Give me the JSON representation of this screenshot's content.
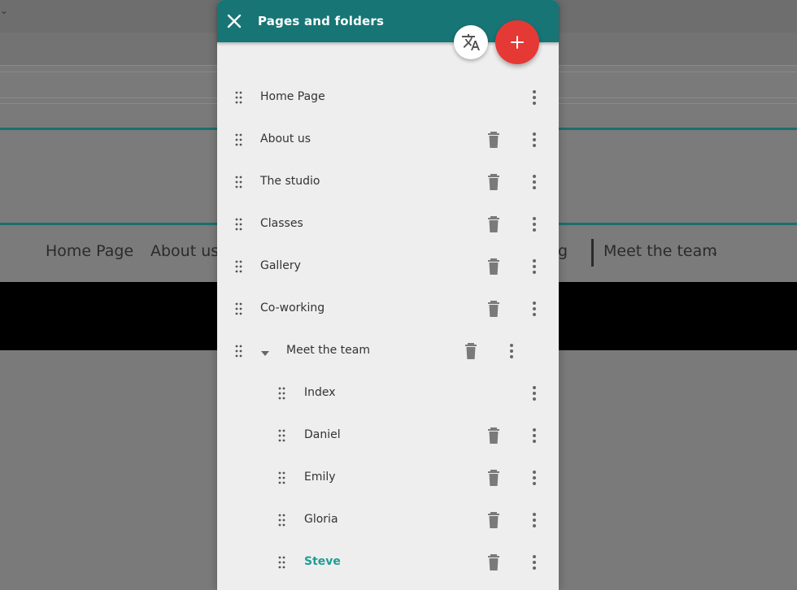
{
  "background": {
    "nav_items": [
      "Home Page",
      "About us",
      "g",
      "Meet the team"
    ],
    "nav_dropdown_glyph": "⌄"
  },
  "dialog": {
    "title": "Pages and folders",
    "close_icon": "close-icon",
    "translate_icon": "translate-icon",
    "add_icon": "plus-icon",
    "colors": {
      "header": "#177575",
      "add_button": "#e53935",
      "active_text": "#1e9e96"
    }
  },
  "pages": [
    {
      "label": "Home Page",
      "deletable": false,
      "level": 0
    },
    {
      "label": "About us",
      "deletable": true,
      "level": 0
    },
    {
      "label": "The studio",
      "deletable": true,
      "level": 0
    },
    {
      "label": "Classes",
      "deletable": true,
      "level": 0
    },
    {
      "label": "Gallery",
      "deletable": true,
      "level": 0
    },
    {
      "label": "Co-working",
      "deletable": true,
      "level": 0
    },
    {
      "label": "Meet the team",
      "deletable": true,
      "level": 0,
      "folder": true,
      "expanded": true
    },
    {
      "label": "Index",
      "deletable": false,
      "level": 1
    },
    {
      "label": "Daniel",
      "deletable": true,
      "level": 1
    },
    {
      "label": "Emily",
      "deletable": true,
      "level": 1
    },
    {
      "label": "Gloria",
      "deletable": true,
      "level": 1
    },
    {
      "label": "Steve",
      "deletable": true,
      "level": 1,
      "active": true
    }
  ]
}
